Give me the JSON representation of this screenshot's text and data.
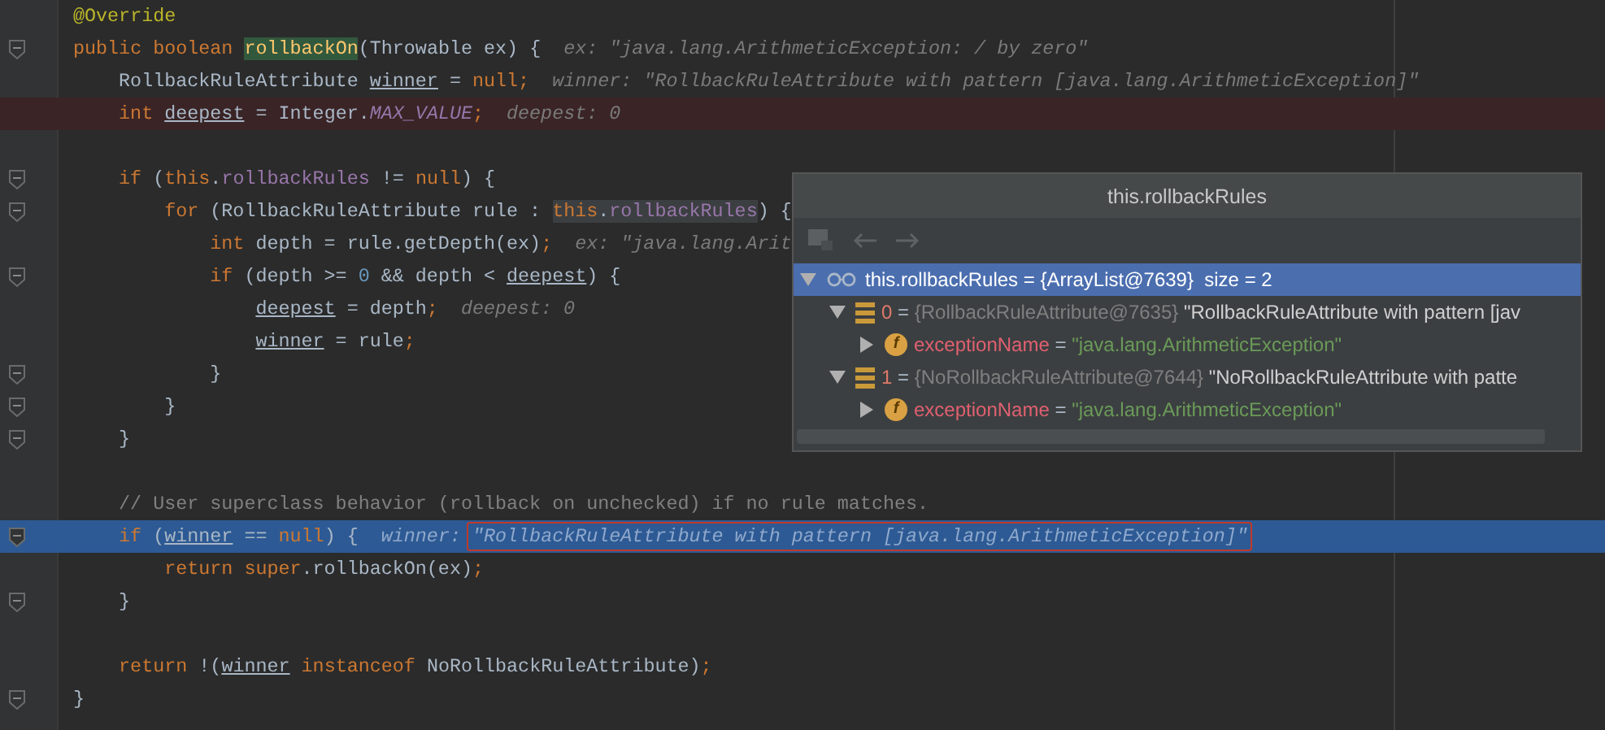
{
  "editor": {
    "lines": [
      {
        "breakpoint": false,
        "current": false,
        "fold_marker": false,
        "tokens": [
          {
            "kind": "annotation",
            "text": "@Override"
          }
        ]
      },
      {
        "breakpoint": false,
        "current": false,
        "fold_marker": true,
        "tokens": [
          {
            "kind": "keyword",
            "text": "public boolean "
          },
          {
            "kind": "method-def",
            "text": "rollbackOn"
          },
          {
            "kind": "plain",
            "text": "(Throwable ex) {"
          }
        ],
        "hint": {
          "label": "ex:",
          "value": "\"java.lang.ArithmeticException: / by zero\"",
          "boxed": false
        },
        "children": [
          {
            "breakpoint": false,
            "current": false,
            "fold_marker": false,
            "tokens": [
              {
                "kind": "plain",
                "text": "RollbackRuleAttribute "
              },
              {
                "kind": "variable",
                "text": "winner"
              },
              {
                "kind": "plain",
                "text": " = "
              },
              {
                "kind": "keyword",
                "text": "null;"
              }
            ],
            "hint": {
              "label": "winner:",
              "value": "\"RollbackRuleAttribute with pattern [java.lang.ArithmeticException]\"",
              "boxed": false
            }
          },
          {
            "breakpoint": true,
            "current": false,
            "fold_marker": false,
            "tokens": [
              {
                "kind": "keyword",
                "text": "int "
              },
              {
                "kind": "variable",
                "text": "deepest"
              },
              {
                "kind": "plain",
                "text": " = Integer."
              },
              {
                "kind": "static",
                "text": "MAX_VALUE"
              },
              {
                "kind": "keyword",
                "text": ";"
              }
            ],
            "hint": {
              "label": "deepest:",
              "value": "0",
              "boxed": false
            }
          },
          {
            "breakpoint": false,
            "current": false,
            "fold_marker": false
          },
          {
            "breakpoint": false,
            "current": false,
            "fold_marker": true,
            "tokens": [
              {
                "kind": "keyword",
                "text": "if "
              },
              {
                "kind": "plain",
                "text": "("
              },
              {
                "kind": "keyword",
                "text": "this"
              },
              {
                "kind": "plain",
                "text": "."
              },
              {
                "kind": "field",
                "text": "rollbackRules"
              },
              {
                "kind": "plain",
                "text": " != "
              },
              {
                "kind": "keyword",
                "text": "null"
              },
              {
                "kind": "plain",
                "text": ") {"
              }
            ],
            "children": [
              {
                "breakpoint": false,
                "current": false,
                "fold_marker": true,
                "tokens": [
                  {
                    "kind": "keyword",
                    "text": "for "
                  },
                  {
                    "kind": "plain",
                    "text": "(RollbackRuleAttribute rule : "
                  },
                  {
                    "kind": "keyword-usage",
                    "text": "this"
                  },
                  {
                    "kind": "plain-usage",
                    "text": "."
                  },
                  {
                    "kind": "field-usage",
                    "text": "rollbackRules"
                  },
                  {
                    "kind": "plain",
                    "text": ") {"
                  }
                ],
                "children": [
                  {
                    "breakpoint": false,
                    "current": false,
                    "fold_marker": false,
                    "tokens": [
                      {
                        "kind": "keyword",
                        "text": "int "
                      },
                      {
                        "kind": "plain",
                        "text": "depth = rule.getDepth(ex)"
                      },
                      {
                        "kind": "keyword",
                        "text": ";"
                      }
                    ],
                    "hint": {
                      "label": "ex:",
                      "value": "\"java.lang.Arit",
                      "boxed": false
                    }
                  },
                  {
                    "breakpoint": false,
                    "current": false,
                    "fold_marker": true,
                    "tokens": [
                      {
                        "kind": "keyword",
                        "text": "if "
                      },
                      {
                        "kind": "plain",
                        "text": "(depth >= "
                      },
                      {
                        "kind": "number",
                        "text": "0"
                      },
                      {
                        "kind": "plain",
                        "text": " && depth < "
                      },
                      {
                        "kind": "variable",
                        "text": "deepest"
                      },
                      {
                        "kind": "plain",
                        "text": ") {"
                      }
                    ],
                    "children": [
                      {
                        "breakpoint": false,
                        "current": false,
                        "fold_marker": false,
                        "tokens": [
                          {
                            "kind": "variable",
                            "text": "deepest"
                          },
                          {
                            "kind": "plain",
                            "text": " = depth"
                          },
                          {
                            "kind": "keyword",
                            "text": ";"
                          }
                        ],
                        "hint": {
                          "label": "deepest:",
                          "value": "0",
                          "boxed": false
                        }
                      },
                      {
                        "breakpoint": false,
                        "current": false,
                        "fold_marker": false,
                        "tokens": [
                          {
                            "kind": "variable",
                            "text": "winner"
                          },
                          {
                            "kind": "plain",
                            "text": " = rule"
                          },
                          {
                            "kind": "keyword",
                            "text": ";"
                          }
                        ]
                      }
                    ]
                  },
                  {
                    "breakpoint": false,
                    "current": false,
                    "fold_marker": true,
                    "tokens": [
                      {
                        "kind": "plain",
                        "text": "}"
                      }
                    ]
                  }
                ]
              },
              {
                "breakpoint": false,
                "current": false,
                "fold_marker": true,
                "tokens": [
                  {
                    "kind": "plain",
                    "text": "}"
                  }
                ]
              }
            ]
          },
          {
            "breakpoint": false,
            "current": false,
            "fold_marker": true,
            "tokens": [
              {
                "kind": "plain",
                "text": "}"
              }
            ]
          },
          {
            "breakpoint": false,
            "current": false,
            "fold_marker": false
          },
          {
            "breakpoint": false,
            "current": false,
            "fold_marker": false,
            "tokens": [
              {
                "kind": "comment",
                "text": "// User superclass behavior (rollback on unchecked) if no rule matches."
              }
            ]
          },
          {
            "breakpoint": false,
            "current": true,
            "fold_marker": true,
            "tokens": [
              {
                "kind": "keyword",
                "text": "if "
              },
              {
                "kind": "plain",
                "text": "("
              },
              {
                "kind": "variable",
                "text": "winner"
              },
              {
                "kind": "plain",
                "text": " == "
              },
              {
                "kind": "keyword",
                "text": "null"
              },
              {
                "kind": "plain",
                "text": ") {"
              }
            ],
            "hint": {
              "label": "winner:",
              "value": "\"RollbackRuleAttribute with pattern [java.lang.ArithmeticException]\"",
              "boxed": true
            },
            "children": [
              {
                "breakpoint": false,
                "current": false,
                "fold_marker": false,
                "tokens": [
                  {
                    "kind": "keyword",
                    "text": "return super"
                  },
                  {
                    "kind": "plain",
                    "text": ".rollbackOn(ex)"
                  },
                  {
                    "kind": "keyword",
                    "text": ";"
                  }
                ]
              }
            ]
          },
          {
            "breakpoint": false,
            "current": false,
            "fold_marker": true,
            "tokens": [
              {
                "kind": "plain",
                "text": "}"
              }
            ]
          },
          {
            "breakpoint": false,
            "current": false,
            "fold_marker": false
          },
          {
            "breakpoint": false,
            "current": false,
            "fold_marker": false,
            "tokens": [
              {
                "kind": "keyword",
                "text": "return "
              },
              {
                "kind": "plain",
                "text": "!("
              },
              {
                "kind": "variable",
                "text": "winner"
              },
              {
                "kind": "keyword",
                "text": " instanceof "
              },
              {
                "kind": "plain",
                "text": "NoRollbackRuleAttribute)"
              },
              {
                "kind": "keyword",
                "text": ";"
              }
            ]
          }
        ]
      },
      {
        "breakpoint": false,
        "current": false,
        "fold_marker": true,
        "tokens": [
          {
            "kind": "plain",
            "text": "}"
          }
        ]
      }
    ]
  },
  "popup": {
    "title": "this.rollbackRules",
    "tree": [
      {
        "kind": "list",
        "name": "this.rollbackRules",
        "operator": "=",
        "type": "{ArrayList@7639}",
        "value": "size = 2",
        "expanded": true,
        "selected": true,
        "children": [
          {
            "kind": "element",
            "name": "0",
            "operator": "=",
            "type": "{RollbackRuleAttribute@7635}",
            "value": "\"RollbackRuleAttribute with pattern [jav",
            "expanded": true,
            "selected": false,
            "children": [
              {
                "kind": "field",
                "badge": "f",
                "name": "exceptionName",
                "operator": "=",
                "value": "\"java.lang.ArithmeticException\"",
                "expanded": false,
                "selected": false
              }
            ]
          },
          {
            "kind": "element",
            "name": "1",
            "operator": "=",
            "type": "{NoRollbackRuleAttribute@7644}",
            "value": "\"NoRollbackRuleAttribute with patte",
            "expanded": true,
            "selected": false,
            "children": [
              {
                "kind": "field",
                "badge": "f",
                "name": "exceptionName",
                "operator": "=",
                "value": "\"java.lang.ArithmeticException\"",
                "expanded": false,
                "selected": false
              }
            ]
          }
        ]
      }
    ]
  }
}
